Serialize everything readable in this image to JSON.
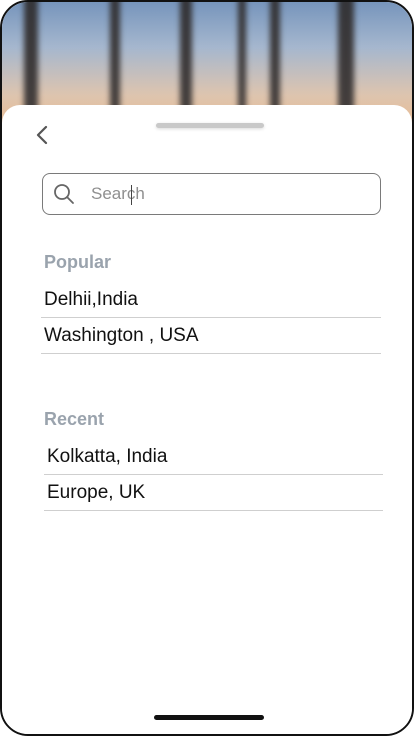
{
  "search": {
    "placeholder": "Search"
  },
  "popular": {
    "title": "Popular",
    "items": [
      "Delhii,India",
      "Washington , USA"
    ]
  },
  "recent": {
    "title": "Recent",
    "items": [
      "Kolkatta, India",
      "Europe, UK"
    ]
  },
  "icons": {
    "back": "chevron-left-icon",
    "search": "search-icon"
  },
  "colors": {
    "section_title": "#9aa3ad",
    "divider": "#cfcfcf",
    "border": "#7a7a7a"
  }
}
